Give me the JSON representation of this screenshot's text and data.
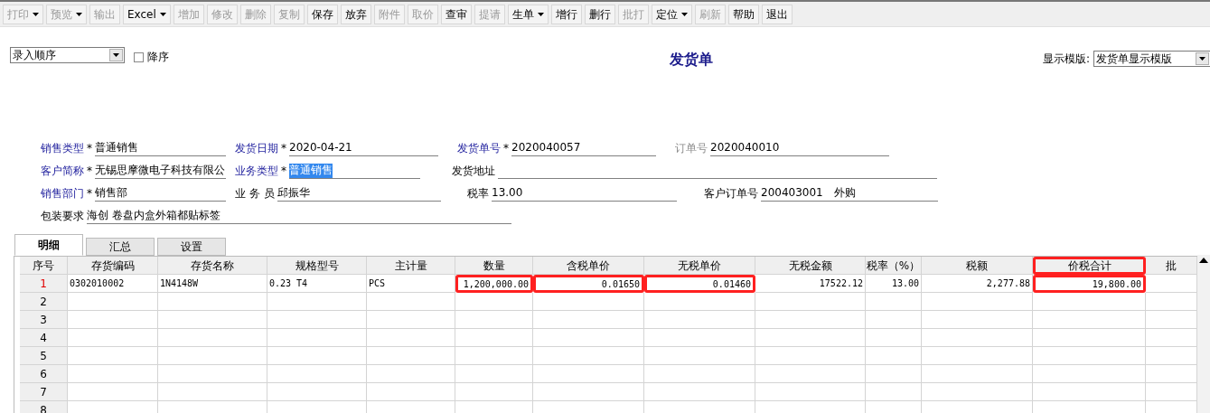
{
  "toolbar": [
    {
      "label": "打印",
      "disabled": true,
      "dropdown": true
    },
    {
      "label": "预览",
      "disabled": true,
      "dropdown": true
    },
    {
      "label": "输出",
      "disabled": true,
      "dropdown": false
    },
    {
      "label": "Excel",
      "disabled": false,
      "dropdown": true
    },
    {
      "label": "增加",
      "disabled": true,
      "dropdown": false
    },
    {
      "label": "修改",
      "disabled": true,
      "dropdown": false
    },
    {
      "label": "删除",
      "disabled": true,
      "dropdown": false
    },
    {
      "label": "复制",
      "disabled": true,
      "dropdown": false
    },
    {
      "label": "保存",
      "disabled": false,
      "dropdown": false
    },
    {
      "label": "放弃",
      "disabled": false,
      "dropdown": false
    },
    {
      "label": "附件",
      "disabled": true,
      "dropdown": false
    },
    {
      "label": "取价",
      "disabled": true,
      "dropdown": false
    },
    {
      "label": "查审",
      "disabled": false,
      "dropdown": false
    },
    {
      "label": "提请",
      "disabled": true,
      "dropdown": false
    },
    {
      "label": "生单",
      "disabled": false,
      "dropdown": true
    },
    {
      "label": "增行",
      "disabled": false,
      "dropdown": false
    },
    {
      "label": "删行",
      "disabled": false,
      "dropdown": false
    },
    {
      "label": "批打",
      "disabled": true,
      "dropdown": false
    },
    {
      "label": "定位",
      "disabled": false,
      "dropdown": true
    },
    {
      "label": "刷新",
      "disabled": true,
      "dropdown": false
    },
    {
      "label": "帮助",
      "disabled": false,
      "dropdown": false
    },
    {
      "label": "退出",
      "disabled": false,
      "dropdown": false
    }
  ],
  "sort_select": {
    "value": "录入顺序"
  },
  "descending": {
    "label": "降序",
    "checked": false
  },
  "title": "发货单",
  "required_mark": "*",
  "template": {
    "label": "显示模版:",
    "value": "发货单显示模版"
  },
  "form_rows": [
    [
      {
        "label": "销售类型",
        "required": true,
        "disabled": false,
        "value": "普通销售",
        "text_selected": false
      },
      {
        "label": "发货日期",
        "required": true,
        "disabled": false,
        "value": "2020-04-21",
        "text_selected": false
      },
      {
        "label": "发货单号",
        "required": true,
        "disabled": false,
        "value": "2020040057",
        "text_selected": false
      },
      {
        "label": "订单号",
        "required": false,
        "disabled": true,
        "value": "2020040010",
        "text_selected": false
      }
    ],
    [
      {
        "label": "客户简称",
        "required": true,
        "disabled": false,
        "value": "无锡思摩微电子科技有限公",
        "text_selected": false
      },
      {
        "label": "业务类型",
        "required": true,
        "disabled": false,
        "value": "普通销售",
        "text_selected": true
      },
      {
        "label": "发货地址",
        "required": false,
        "disabled": false
      }
    ],
    [
      {
        "label": "销售部门",
        "required": true,
        "disabled": false,
        "value": "销售部",
        "text_selected": false
      },
      {
        "label": "业 务 员",
        "required": false,
        "disabled": false,
        "value": "邱振华",
        "text_selected": false
      },
      {
        "label": "税率",
        "required": false,
        "disabled": false,
        "value": "13.00",
        "text_selected": false
      },
      {
        "label": "客户订单号",
        "required": false,
        "disabled": false,
        "value": "200403001　外购",
        "text_selected": false
      }
    ],
    [
      {
        "label": "包装要求",
        "required": false,
        "disabled": false,
        "value": "海创 卷盘内盒外箱都贴标签",
        "text_selected": false
      }
    ]
  ],
  "tabs": [
    {
      "label": "明细",
      "selected": true
    },
    {
      "label": "汇总",
      "selected": false
    },
    {
      "label": "设置",
      "selected": false
    }
  ],
  "table": {
    "columns": [
      {
        "label": "序号",
        "highlighted": false
      },
      {
        "label": "存货编码",
        "highlighted": false
      },
      {
        "label": "存货名称",
        "highlighted": false
      },
      {
        "label": "规格型号",
        "highlighted": false
      },
      {
        "label": "主计量",
        "highlighted": false
      },
      {
        "label": "数量",
        "highlighted": false
      },
      {
        "label": "含税单价",
        "highlighted": false
      },
      {
        "label": "无税单价",
        "highlighted": false
      },
      {
        "label": "无税金额",
        "highlighted": false
      },
      {
        "label": "税率（%）",
        "highlighted": false
      },
      {
        "label": "税额",
        "highlighted": false
      },
      {
        "label": "价税合计",
        "highlighted": true
      },
      {
        "label": "批",
        "highlighted": false
      }
    ],
    "rows": [
      {
        "no": "1",
        "selected": true,
        "cells": [
          {
            "text": "0302010002",
            "highlighted": false
          },
          {
            "text": "1N4148W",
            "highlighted": false
          },
          {
            "text": "0.23 T4",
            "highlighted": false
          },
          {
            "text": "PCS",
            "highlighted": false
          },
          {
            "text": "1,200,000.00",
            "highlighted": true
          },
          {
            "text": "0.01650",
            "highlighted": true
          },
          {
            "text": "0.01460",
            "highlighted": true
          },
          {
            "text": "17522.12",
            "highlighted": false
          },
          {
            "text": "13.00",
            "highlighted": false
          },
          {
            "text": "2,277.88",
            "highlighted": false
          },
          {
            "text": "19,800.00",
            "highlighted": true
          }
        ]
      },
      {
        "no": "2",
        "selected": false
      },
      {
        "no": "3",
        "selected": false
      },
      {
        "no": "4",
        "selected": false
      },
      {
        "no": "5",
        "selected": false
      },
      {
        "no": "6",
        "selected": false
      },
      {
        "no": "7",
        "selected": false
      },
      {
        "no": "8",
        "selected": false
      }
    ]
  }
}
